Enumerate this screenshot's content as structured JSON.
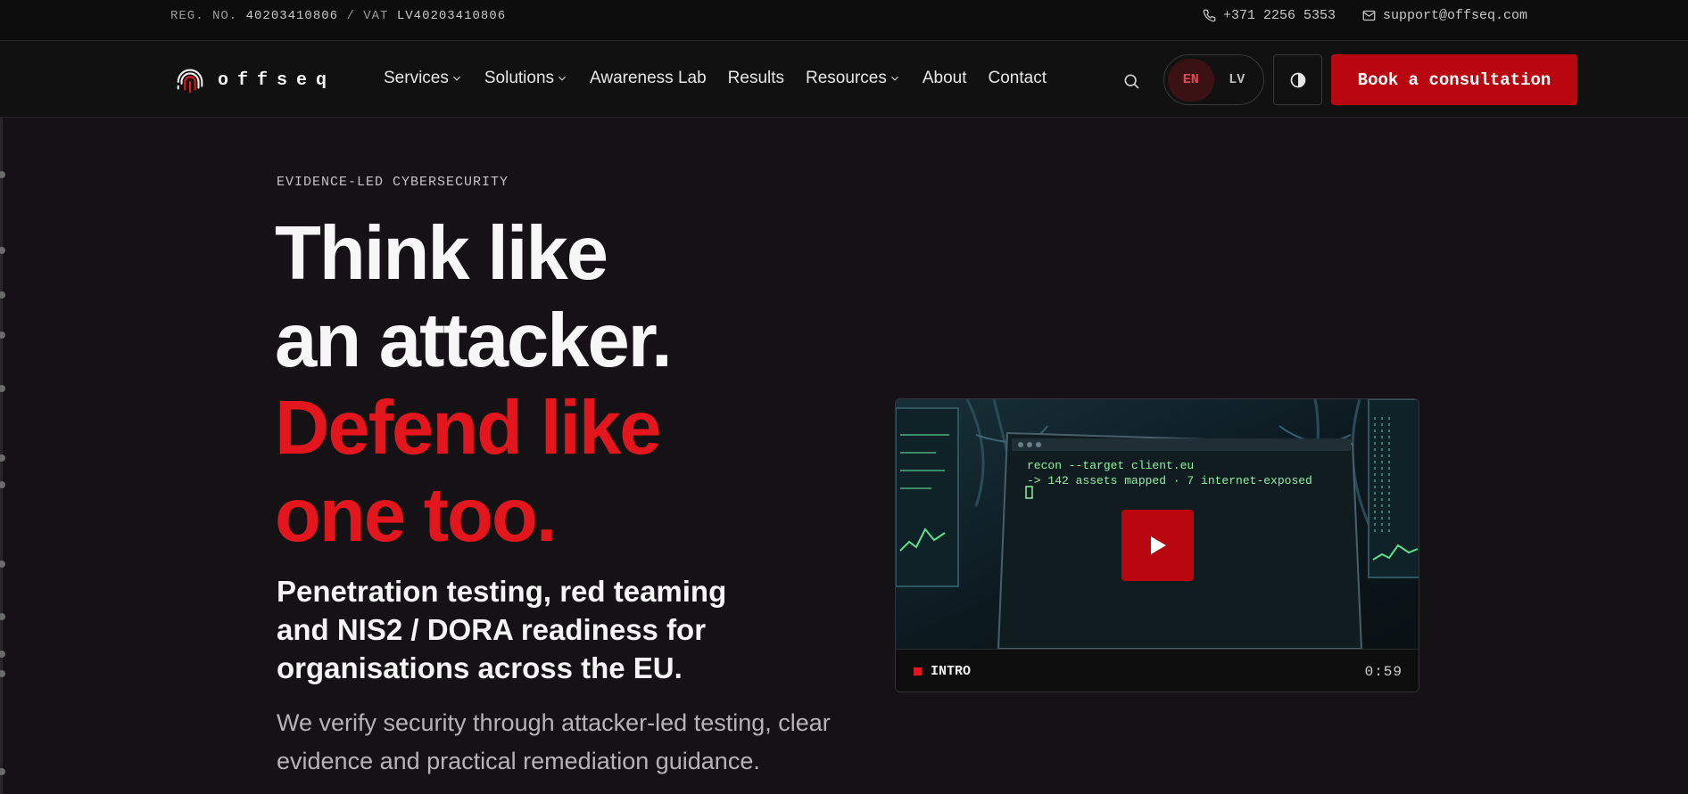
{
  "topbar": {
    "reg_label": "REG. NO.",
    "reg_number": "40203410806",
    "vat_label": "/ VAT",
    "vat_number": "LV40203410806",
    "phone": "+371 2256 5353",
    "email": "support@offseq.com"
  },
  "nav": {
    "logo_text": "offseq",
    "items": [
      {
        "label": "Services",
        "has_dropdown": true
      },
      {
        "label": "Solutions",
        "has_dropdown": true
      },
      {
        "label": "Awareness Lab",
        "has_dropdown": false
      },
      {
        "label": "Results",
        "has_dropdown": false
      },
      {
        "label": "Resources",
        "has_dropdown": true
      },
      {
        "label": "About",
        "has_dropdown": false
      },
      {
        "label": "Contact",
        "has_dropdown": false
      }
    ],
    "lang_active": "EN",
    "lang_inactive": "LV",
    "cta_label": "Book a consultation"
  },
  "hero": {
    "eyebrow": "EVIDENCE-LED CYBERSECURITY",
    "headline_line1": "Think like",
    "headline_line2": "an attacker.",
    "headline_line3": "Defend like",
    "headline_line4": "one too.",
    "subheading": "Penetration testing, red teaming and NIS2 / DORA readiness for organisations across the EU.",
    "body": "We verify security through attacker-led testing, clear evidence and practical remediation guidance."
  },
  "video": {
    "terminal_line1": "recon --target client.eu",
    "terminal_line2": "-> 142 assets mapped · 7 internet-exposed",
    "label": "INTRO",
    "duration": "0:59"
  },
  "colors": {
    "accent_red": "#b8070f",
    "headline_red": "#e3161d",
    "background": "#141214",
    "terminal_green": "#8ef0a0"
  },
  "icons": {
    "phone": "phone-icon",
    "email": "mail-icon",
    "search": "search-icon",
    "theme": "contrast-icon",
    "play": "play-icon",
    "logo": "fingerprint-icon"
  }
}
